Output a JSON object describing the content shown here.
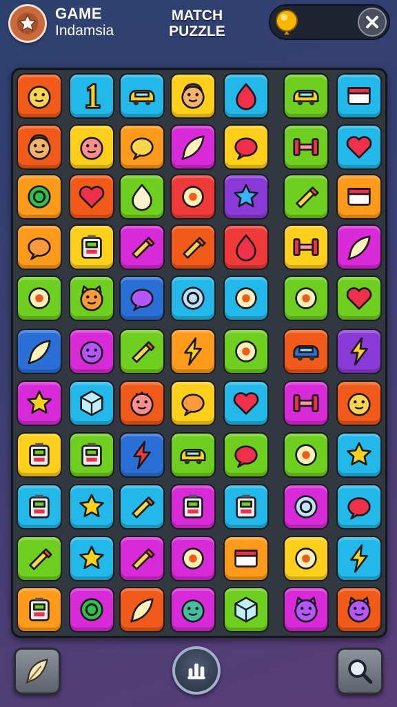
{
  "header": {
    "brand_line1": "GAME",
    "brand_line2": "Indamsia",
    "title_line1": "MATCH",
    "title_line2": "PUZZLE",
    "logo_icon": "star-icon",
    "currency_icon": "coin-icon",
    "close_icon": "close-icon"
  },
  "board": {
    "tiles": [
      [
        {
          "color": "#f25a1a",
          "icon": "smiley-face-icon"
        },
        {
          "color": "#22b8ea",
          "icon": "number-one-icon"
        },
        {
          "color": "#22b8ea",
          "icon": "card-icon"
        },
        {
          "color": "#ffcf1a",
          "icon": "boy-face-icon"
        },
        {
          "color": "#22b8ea",
          "icon": "red-drop-icon"
        },
        {
          "color": "#6fcf1e",
          "icon": "car-icon"
        },
        {
          "color": "#22b8ea",
          "icon": "folder-icon"
        }
      ],
      [
        {
          "color": "#f25a1a",
          "icon": "man-face-icon"
        },
        {
          "color": "#ffcf1a",
          "icon": "girl-face-icon"
        },
        {
          "color": "#ff9a1a",
          "icon": "chat-bubble-icon"
        },
        {
          "color": "#d82ad8",
          "icon": "paper-plane-icon"
        },
        {
          "color": "#ffcf1a",
          "icon": "leaf-icon"
        },
        {
          "color": "#6fcf1e",
          "icon": "bridge-icon"
        },
        {
          "color": "#22b8ea",
          "icon": "heart-icon"
        }
      ],
      [
        {
          "color": "#ff9a1a",
          "icon": "green-orb-icon"
        },
        {
          "color": "#f25a1a",
          "icon": "gem-heart-icon"
        },
        {
          "color": "#6fcf1e",
          "icon": "flame-icon"
        },
        {
          "color": "#f03a3a",
          "icon": "puzzle-icon"
        },
        {
          "color": "#8a3ad6",
          "icon": "star-icon"
        },
        {
          "color": "#6fcf1e",
          "icon": "brush-icon"
        },
        {
          "color": "#ff9a1a",
          "icon": "book-icon"
        }
      ],
      [
        {
          "color": "#ff9a1a",
          "icon": "bean-icon"
        },
        {
          "color": "#ffcf1a",
          "icon": "jar-icon"
        },
        {
          "color": "#d82ad8",
          "icon": "pencil-icon"
        },
        {
          "color": "#f25a1a",
          "icon": "wrench-icon"
        },
        {
          "color": "#f03a3a",
          "icon": "fruit-icon"
        },
        {
          "color": "#ffcf1a",
          "icon": "dumbbell-icon"
        },
        {
          "color": "#d82ad8",
          "icon": "splash-icon"
        }
      ],
      [
        {
          "color": "#6fcf1e",
          "icon": "swirl-icon"
        },
        {
          "color": "#6fcf1e",
          "icon": "cat-face-icon"
        },
        {
          "color": "#2a6fd6",
          "icon": "blob-icon"
        },
        {
          "color": "#22b8ea",
          "icon": "ring-icon"
        },
        {
          "color": "#22b8ea",
          "icon": "squirrel-icon"
        },
        {
          "color": "#6fcf1e",
          "icon": "tools-icon"
        },
        {
          "color": "#6fcf1e",
          "icon": "heart-icon"
        }
      ],
      [
        {
          "color": "#2a6fd6",
          "icon": "burst-icon"
        },
        {
          "color": "#d82ad8",
          "icon": "purple-face-icon"
        },
        {
          "color": "#6fcf1e",
          "icon": "torch-icon"
        },
        {
          "color": "#ff9a1a",
          "icon": "lightning-icon"
        },
        {
          "color": "#6fcf1e",
          "icon": "crossed-swords-icon"
        },
        {
          "color": "#f25a1a",
          "icon": "beetle-car-icon"
        },
        {
          "color": "#8a3ad6",
          "icon": "bolt-icon"
        }
      ],
      [
        {
          "color": "#d82ad8",
          "icon": "moon-star-icon"
        },
        {
          "color": "#22b8ea",
          "icon": "cube-icon"
        },
        {
          "color": "#f25a1a",
          "icon": "princess-face-icon"
        },
        {
          "color": "#ffcf1a",
          "icon": "cloud-icon"
        },
        {
          "color": "#22b8ea",
          "icon": "heart-icon"
        },
        {
          "color": "#d82ad8",
          "icon": "bow-icon"
        },
        {
          "color": "#f25a1a",
          "icon": "smiley-face-icon"
        }
      ],
      [
        {
          "color": "#ffcf1a",
          "icon": "calculator-icon"
        },
        {
          "color": "#6fcf1e",
          "icon": "battery-icon"
        },
        {
          "color": "#2a6fd6",
          "icon": "lightning-icon"
        },
        {
          "color": "#6fcf1e",
          "icon": "car-icon"
        },
        {
          "color": "#6fcf1e",
          "icon": "speech-bubble-icon"
        },
        {
          "color": "#6fcf1e",
          "icon": "ice-cream-icon"
        },
        {
          "color": "#22b8ea",
          "icon": "star-icon"
        }
      ],
      [
        {
          "color": "#22b8ea",
          "icon": "battery-icon"
        },
        {
          "color": "#22b8ea",
          "icon": "star-icon"
        },
        {
          "color": "#22b8ea",
          "icon": "torch-icon"
        },
        {
          "color": "#d82ad8",
          "icon": "game-controller-icon"
        },
        {
          "color": "#22b8ea",
          "icon": "radio-icon"
        },
        {
          "color": "#d82ad8",
          "icon": "target-icon"
        },
        {
          "color": "#22b8ea",
          "icon": "leaf-icon"
        }
      ],
      [
        {
          "color": "#6fcf1e",
          "icon": "brush-icon"
        },
        {
          "color": "#22b8ea",
          "icon": "star-icon"
        },
        {
          "color": "#d82ad8",
          "icon": "microphone-icon"
        },
        {
          "color": "#d82ad8",
          "icon": "ghost-icon"
        },
        {
          "color": "#ff9a1a",
          "icon": "envelope-icon"
        },
        {
          "color": "#ffcf1a",
          "icon": "cookie-icon"
        },
        {
          "color": "#22b8ea",
          "icon": "lightning-icon"
        }
      ],
      [
        {
          "color": "#ff9a1a",
          "icon": "radio-icon"
        },
        {
          "color": "#d82ad8",
          "icon": "green-orb-icon"
        },
        {
          "color": "#f25a1a",
          "icon": "feather-icon"
        },
        {
          "color": "#d82ad8",
          "icon": "alien-face-icon"
        },
        {
          "color": "#6fcf1e",
          "icon": "shield-icon"
        },
        {
          "color": "#d82ad8",
          "icon": "devil-face-icon"
        },
        {
          "color": "#f25a1a",
          "icon": "devil-face-icon"
        }
      ]
    ]
  },
  "footer": {
    "left_button_icon": "feather-icon",
    "center_button_icon": "leaderboard-icon",
    "right_button_icon": "magnifier-icon"
  }
}
